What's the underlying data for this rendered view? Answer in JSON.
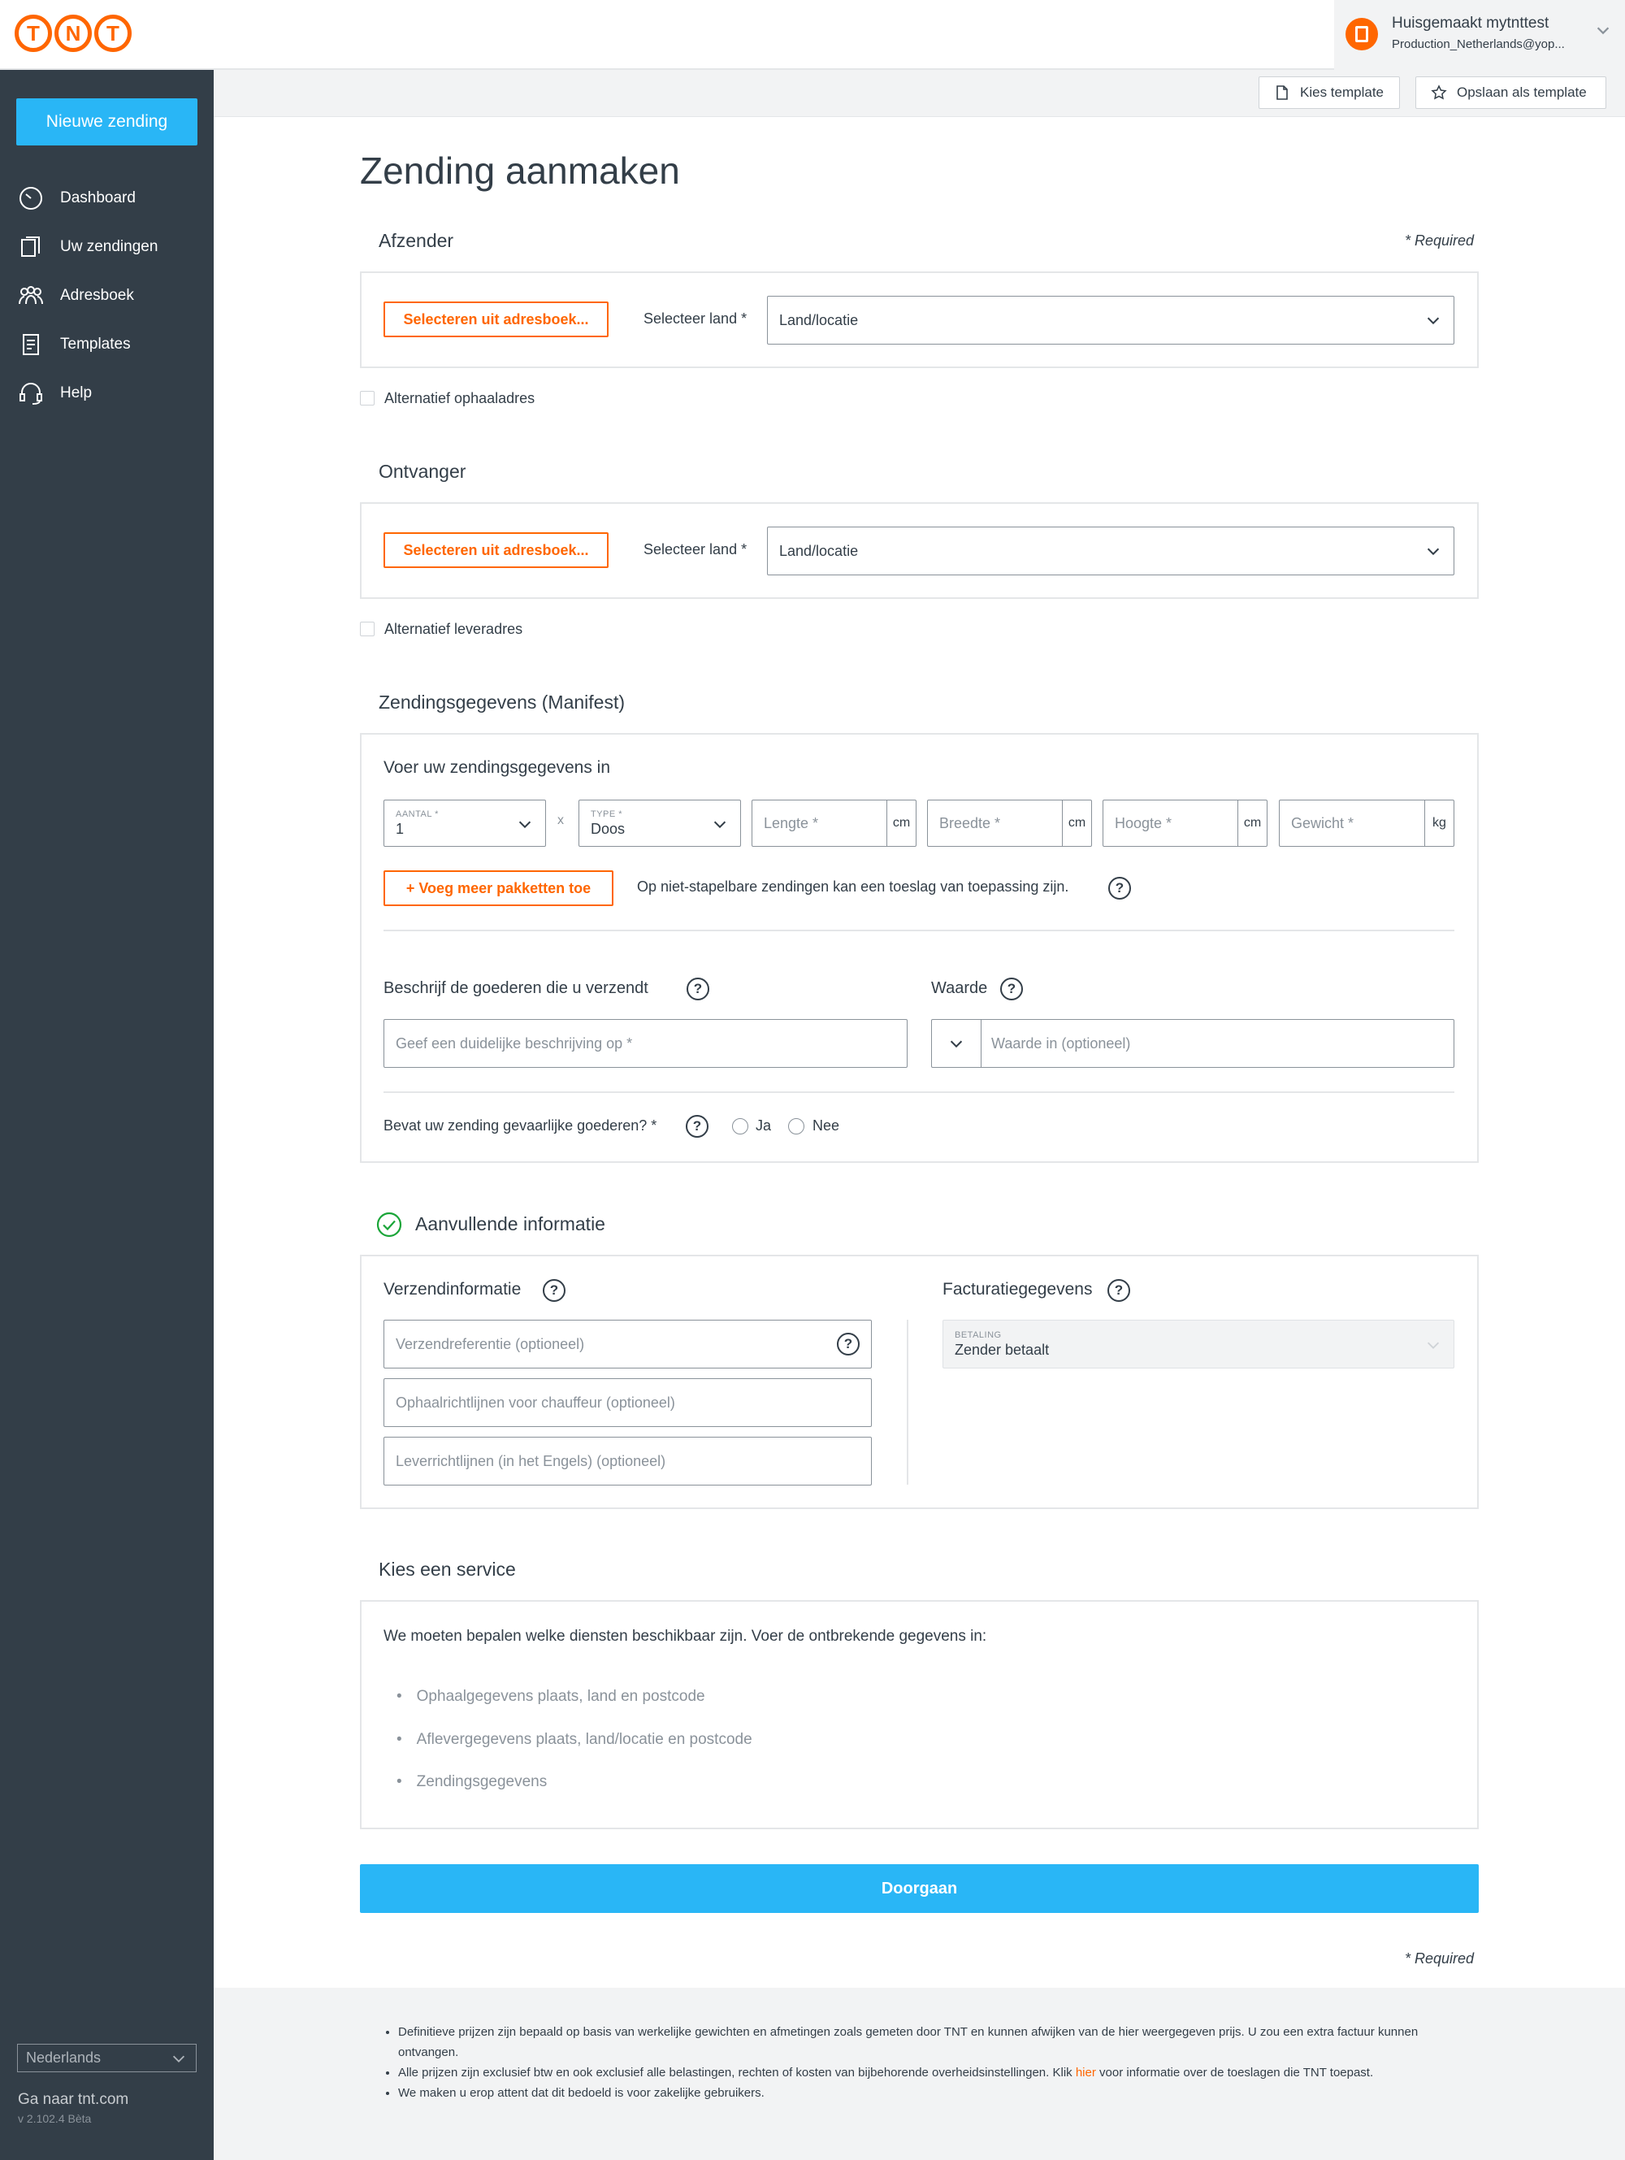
{
  "header": {
    "logo_letters": [
      "T",
      "N",
      "T"
    ],
    "account_name": "Huisgemaakt mytnttest",
    "account_email": "Production_Netherlands@yop..."
  },
  "sidebar": {
    "new_shipment": "Nieuwe zending",
    "items": [
      {
        "label": "Dashboard",
        "icon": "dashboard-icon"
      },
      {
        "label": "Uw zendingen",
        "icon": "shipments-icon"
      },
      {
        "label": "Adresboek",
        "icon": "addressbook-icon"
      },
      {
        "label": "Templates",
        "icon": "templates-icon"
      },
      {
        "label": "Help",
        "icon": "help-icon"
      }
    ],
    "language": "Nederlands",
    "goto": "Ga naar tnt.com",
    "version": "v 2.102.4 Bèta"
  },
  "toolbar": {
    "choose_template": "Kies template",
    "save_template": "Opslaan als template"
  },
  "page": {
    "title": "Zending aanmaken",
    "required": "* Required"
  },
  "sender": {
    "title": "Afzender",
    "select_addressbook": "Selecteren uit adresboek...",
    "select_country_label": "Selecteer land *",
    "country_value": "Land/locatie",
    "alt_checkbox": "Alternatief ophaaladres"
  },
  "receiver": {
    "title": "Ontvanger",
    "select_addressbook": "Selecteren uit adresboek...",
    "select_country_label": "Selecteer land *",
    "country_value": "Land/locatie",
    "alt_checkbox": "Alternatief leveradres"
  },
  "manifest": {
    "title": "Zendingsgegevens (Manifest)",
    "subtitle": "Voer uw zendingsgegevens in",
    "amount_label": "AANTAL *",
    "amount_value": "1",
    "times": "x",
    "type_label": "TYPE *",
    "type_value": "Doos",
    "length_ph": "Lengte *",
    "width_ph": "Breedte *",
    "height_ph": "Hoogte *",
    "weight_ph": "Gewicht *",
    "unit_cm": "cm",
    "unit_kg": "kg",
    "add_packages": "+ Voeg meer pakketten toe",
    "stack_note": "Op niet-stapelbare zendingen kan een toeslag van toepassing zijn.",
    "describe_label": "Beschrijf de goederen die u verzendt",
    "describe_ph": "Geef een duidelijke beschrijving op *",
    "value_label": "Waarde",
    "value_ph": "Waarde in  (optioneel)",
    "dangerous_label": "Bevat uw zending gevaarlijke goederen? *",
    "yes": "Ja",
    "no": "Nee"
  },
  "additional": {
    "title": "Aanvullende informatie",
    "shipping_info": "Verzendinformatie",
    "reference_ph": "Verzendreferentie (optioneel)",
    "pickup_ph": "Ophaalrichtlijnen voor chauffeur (optioneel)",
    "delivery_ph": "Leverrichtlijnen (in het Engels) (optioneel)",
    "billing": "Facturatiegegevens",
    "payment_label": "BETALING",
    "payment_value": "Zender betaalt"
  },
  "service": {
    "title": "Kies een service",
    "intro": "We moeten bepalen welke diensten beschikbaar zijn. Voer de ontbrekende gegevens in:",
    "missing": [
      "Ophaalgegevens plaats, land en postcode",
      "Aflevergegevens plaats, land/locatie en postcode",
      "Zendingsgegevens"
    ]
  },
  "actions": {
    "continue": "Doorgaan",
    "required": "* Required"
  },
  "footer": {
    "note1": "Definitieve prijzen zijn bepaald op basis van werkelijke gewichten en afmetingen zoals gemeten door TNT en kunnen afwijken van de hier weergegeven prijs. U zou een extra factuur kunnen ontvangen.",
    "note2_before": "Alle prijzen zijn exclusief btw en ook exclusief alle belastingen, rechten of kosten van bijbehorende overheidsinstellingen. Klik ",
    "note2_link": "hier",
    "note2_after": " voor informatie over de toeslagen die TNT toepast.",
    "note3": "We maken u erop attent dat dit bedoeld is voor zakelijke gebruikers."
  },
  "colors": {
    "brand_orange": "#ff6600",
    "primary_blue": "#29b6f6",
    "sidebar_dark": "#333e48",
    "success_green": "#1aa538"
  }
}
